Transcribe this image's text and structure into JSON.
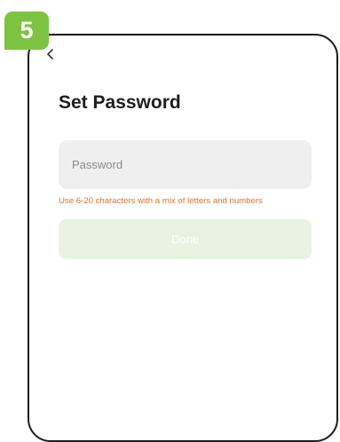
{
  "step_badge": {
    "number": "5",
    "color": "#7ec242"
  },
  "header": {
    "back_icon": "chevron-left-icon"
  },
  "page": {
    "title": "Set Password"
  },
  "password_field": {
    "value": "",
    "placeholder": "Password"
  },
  "hint": {
    "text": "Use 6-20 characters with a mix of letters and numbers",
    "color": "#e0712a"
  },
  "done_button": {
    "label": "Done",
    "enabled": false,
    "background": "#e8f4e1"
  }
}
